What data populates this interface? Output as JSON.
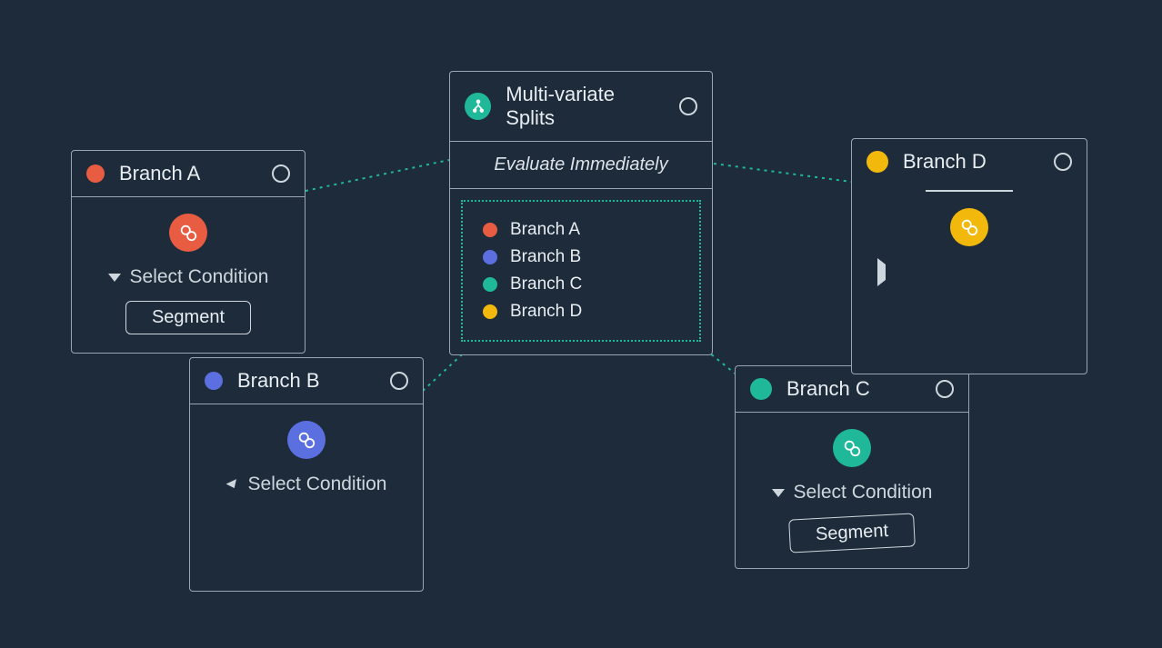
{
  "central": {
    "title": "Multi-variate Splits",
    "subtitle": "Evaluate Immediately",
    "branches": [
      {
        "color": "c-red",
        "label": "Branch A"
      },
      {
        "color": "c-blue",
        "label": "Branch B"
      },
      {
        "color": "c-teal",
        "label": "Branch C"
      },
      {
        "color": "c-yellow",
        "label": "Branch D"
      }
    ]
  },
  "cards": {
    "a": {
      "title": "Branch A",
      "condition": "Select Condition",
      "segment": "Segment"
    },
    "b": {
      "title": "Branch B",
      "condition": "Select Condition"
    },
    "c": {
      "title": "Branch C",
      "condition": "Select Condition",
      "segment": "Segment"
    },
    "d": {
      "title": "Branch D"
    }
  }
}
